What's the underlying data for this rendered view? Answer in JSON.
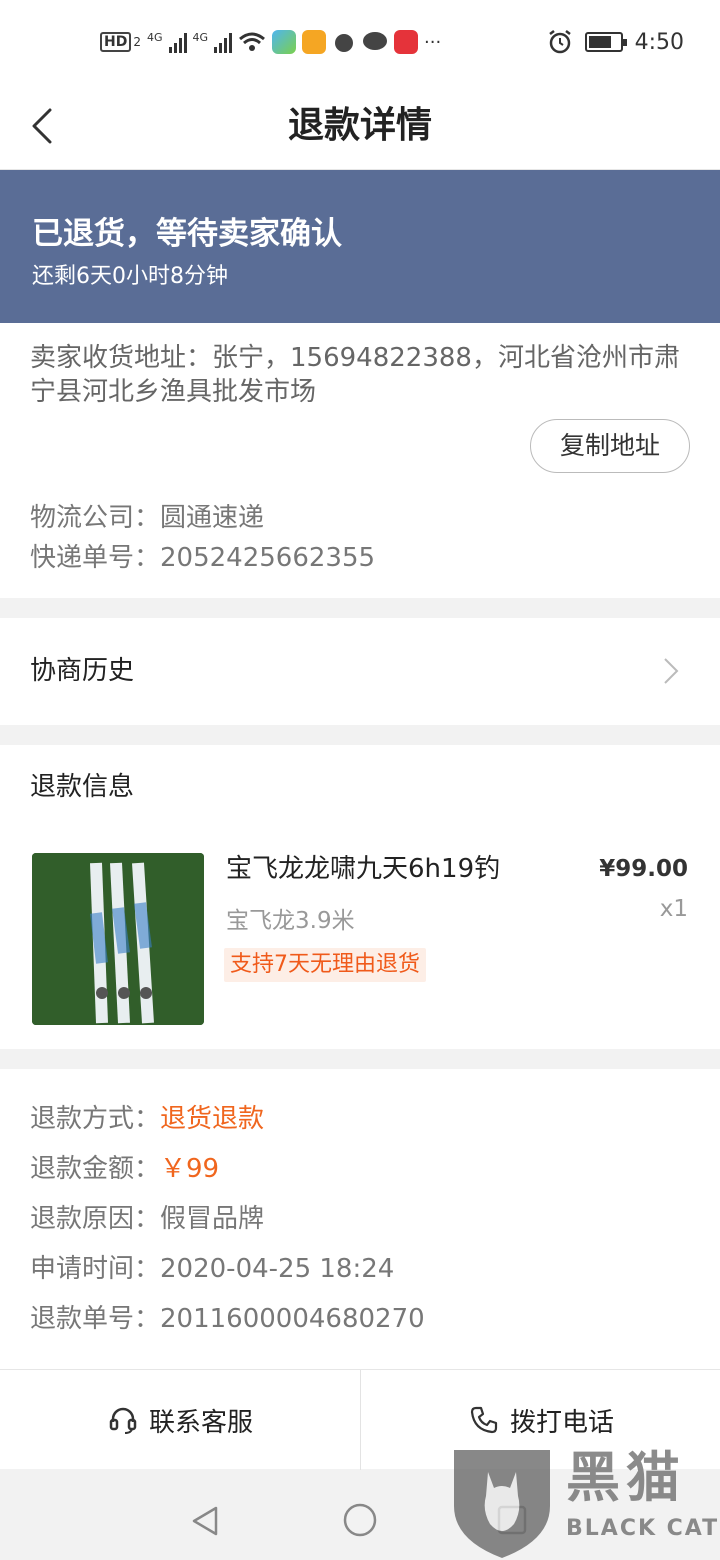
{
  "status_bar": {
    "network": "HD",
    "sim": "2",
    "signal1": "4G",
    "signal2": "4G",
    "more": "···",
    "time": "4:50"
  },
  "nav": {
    "title": "退款详情"
  },
  "status": {
    "main": "已退货，等待卖家确认",
    "countdown": "还剩6天0小时8分钟"
  },
  "address": {
    "text": "卖家收货地址：张宁，15694822388，河北省沧州市肃宁县河北乡渔具批发市场",
    "copy_label": "复制地址",
    "logistics_label": "物流公司：",
    "logistics_value": "圆通速递",
    "tracking_label": "快递单号：",
    "tracking_value": "2052425662355"
  },
  "history": {
    "label": "协商历史"
  },
  "refund_info": {
    "title": "退款信息",
    "product_name": "宝飞龙龙啸九天6h19钓",
    "product_spec": "宝飞龙3.9米",
    "tag": "支持7天无理由退货",
    "price": "¥99.00",
    "qty": "x1"
  },
  "details": {
    "rows": [
      {
        "label": "退款方式：",
        "value": "退货退款",
        "highlight": true
      },
      {
        "label": "退款金额：",
        "value": "￥99",
        "highlight": true
      },
      {
        "label": "退款原因：",
        "value": "假冒品牌",
        "highlight": false
      },
      {
        "label": "申请时间：",
        "value": "2020-04-25 18:24",
        "highlight": false
      },
      {
        "label": "退款单号：",
        "value": "2011600004680270",
        "highlight": false
      }
    ]
  },
  "bottom": {
    "service_label": "联系客服",
    "call_label": "拨打电话"
  },
  "watermark": {
    "cn": "黑猫",
    "en": "BLACK CAT"
  },
  "colors": {
    "banner": "#5a6d96",
    "accent": "#f0661e"
  },
  "icons": [
    "back-arrow-icon",
    "chevron-right-icon",
    "headset-icon",
    "phone-icon",
    "back-triangle-icon",
    "home-circle-icon",
    "recents-square-icon"
  ]
}
